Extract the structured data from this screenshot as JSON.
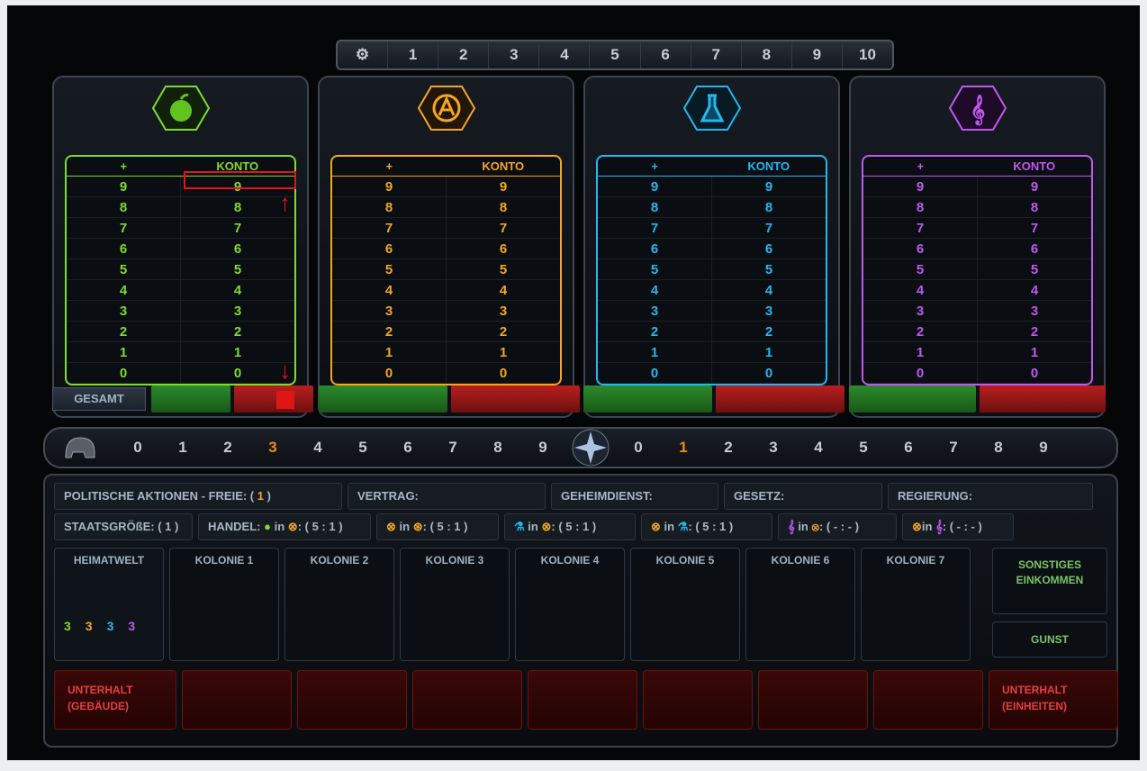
{
  "top_ruler": [
    "1",
    "2",
    "3",
    "4",
    "5",
    "6",
    "7",
    "8",
    "9",
    "10"
  ],
  "colors": {
    "green": "#7fdc2d",
    "orange": "#f5a623",
    "cyan": "#23b8ef",
    "purple": "#c058f0",
    "red": "#e01616"
  },
  "panels": [
    {
      "name": "nahrung",
      "icon": "apple-icon",
      "head_plus": "+",
      "head_konto": "KONTO",
      "rows": [
        "9",
        "8",
        "7",
        "6",
        "5",
        "4",
        "3",
        "2",
        "1",
        "0"
      ]
    },
    {
      "name": "industrie",
      "icon": "cog-emblem-icon",
      "head_plus": "+",
      "head_konto": "KONTO",
      "rows": [
        "9",
        "8",
        "7",
        "6",
        "5",
        "4",
        "3",
        "2",
        "1",
        "0"
      ]
    },
    {
      "name": "wissenschaft",
      "icon": "flask-icon",
      "head_plus": "+",
      "head_konto": "KONTO",
      "rows": [
        "9",
        "8",
        "7",
        "6",
        "5",
        "4",
        "3",
        "2",
        "1",
        "0"
      ]
    },
    {
      "name": "kultur",
      "icon": "treble-clef-icon",
      "head_plus": "+",
      "head_konto": "KONTO",
      "rows": [
        "9",
        "8",
        "7",
        "6",
        "5",
        "4",
        "3",
        "2",
        "1",
        "0"
      ]
    }
  ],
  "gesamt_label": "GESAMT",
  "mid_ruler": {
    "left": [
      "0",
      "1",
      "2",
      "3",
      "4",
      "5",
      "6",
      "7",
      "8",
      "9"
    ],
    "right": [
      "0",
      "1",
      "2",
      "3",
      "4",
      "5",
      "6",
      "7",
      "8",
      "9"
    ],
    "left_highlight": "3",
    "right_highlight": "1"
  },
  "line1": {
    "politische": "POLITISCHE AKTIONEN - FREIE: (",
    "politische_value": "1",
    "politische_close": ")",
    "vertrag": "VERTRAG:",
    "geheimdienst": "GEHEIMDIENST:",
    "gesetz": "GESETZ:",
    "regierung": "REGIERUNG:"
  },
  "line2": {
    "staatsgroesse": "STAATSGRÖßE: ( 1 )",
    "handel": "HANDEL:",
    "t1": "in",
    "t1v": ": ( 5 : 1 )",
    "t2v": ": ( 5 : 1 )",
    "t3": "in",
    "t3v": ": ( 5 : 1 )",
    "t4": "in",
    "t4v": ": ( 5 : 1 )",
    "t5": "in",
    "t5v": ": ( - : - )",
    "t6": "in",
    "t6v": ": ( - : - )"
  },
  "columns": [
    "HEIMATWELT",
    "KOLONIE 1",
    "KOLONIE 2",
    "KOLONIE 3",
    "KOLONIE 4",
    "KOLONIE 5",
    "KOLONIE 6",
    "KOLONIE 7"
  ],
  "home_values": [
    "3",
    "3",
    "3",
    "3"
  ],
  "sonstiges": "SONSTIGES EINKOMMEN",
  "gunst": "GUNST",
  "unterhalt_left": "UNTERHALT (GEBÄUDE)",
  "unterhalt_right": "UNTERHALT (EINHEITEN)"
}
